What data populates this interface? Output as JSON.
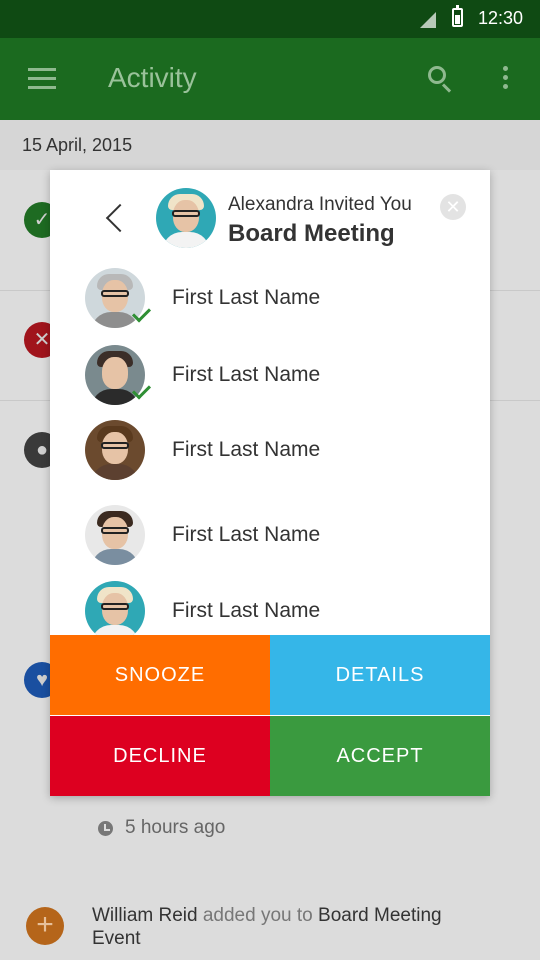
{
  "status_bar": {
    "time": "12:30"
  },
  "app_bar": {
    "title": "Activity"
  },
  "date_header": "15 April, 2015",
  "dialog": {
    "inviter_text": "Alexandra Invited You",
    "event_title": "Board Meeting",
    "attendees": [
      {
        "name": "First Last Name",
        "accepted": true
      },
      {
        "name": "First Last Name",
        "accepted": true
      },
      {
        "name": "First Last Name",
        "accepted": false
      },
      {
        "name": "First Last Name",
        "accepted": false
      },
      {
        "name": "First Last Name",
        "accepted": false
      }
    ],
    "buttons": {
      "snooze": "SNOOZE",
      "details": "DETAILS",
      "decline": "DECLINE",
      "accept": "ACCEPT"
    }
  },
  "feed": {
    "time_ago": "5 hours ago",
    "actor": "William Reid",
    "action": "added you to",
    "target": "Board Meeting Event"
  },
  "colors": {
    "status_bar": "#0f4a13",
    "app_bar": "#1b6a1f",
    "snooze": "#ff6d00",
    "details": "#35b6e8",
    "decline": "#dd0020",
    "accept": "#3a9a3f"
  }
}
